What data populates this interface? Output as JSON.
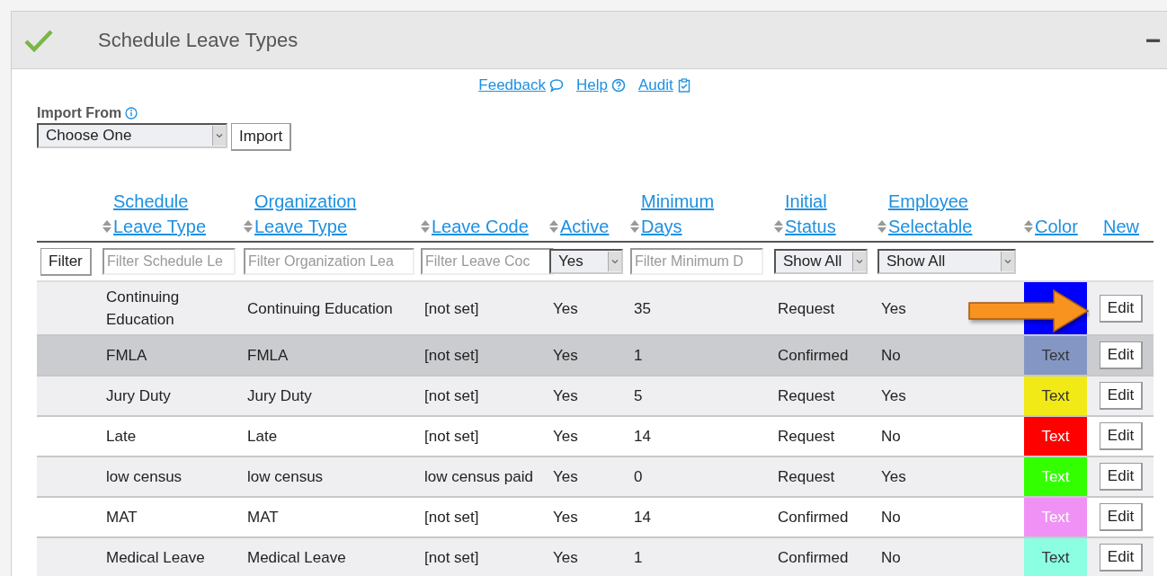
{
  "panel": {
    "title": "Schedule Leave Types",
    "collapse": "−"
  },
  "links": [
    {
      "label": "Feedback",
      "kind": "speech"
    },
    {
      "label": "Help",
      "kind": "help"
    },
    {
      "label": "Audit",
      "kind": "clipboard"
    }
  ],
  "import": {
    "label": "Import From",
    "select": "Choose One",
    "button": "Import"
  },
  "table": {
    "filter_button": "Filter",
    "columns": [
      {
        "label": "Schedule\nLeave Type",
        "sortable": true,
        "filter": {
          "kind": "text",
          "placeholder": "Filter Schedule Le"
        }
      },
      {
        "label": "Organization\nLeave Type",
        "sortable": true,
        "filter": {
          "kind": "text",
          "placeholder": "Filter Organization Lea"
        }
      },
      {
        "label": "Leave Code",
        "sortable": true,
        "filter": {
          "kind": "text",
          "placeholder": "Filter Leave Coc"
        }
      },
      {
        "label": "Active",
        "sortable": true,
        "filter": {
          "kind": "select",
          "value": "Yes"
        }
      },
      {
        "label": "Minimum\nDays",
        "sortable": true,
        "filter": {
          "kind": "text",
          "placeholder": "Filter Minimum D"
        }
      },
      {
        "label": "Initial\nStatus",
        "sortable": true,
        "filter": {
          "kind": "select",
          "value": "Show All"
        }
      },
      {
        "label": "Employee\nSelectable",
        "sortable": true,
        "filter": {
          "kind": "select",
          "value": "Show All"
        }
      },
      {
        "label": "Color",
        "sortable": true
      },
      {
        "label": "New",
        "sortable": false
      }
    ],
    "rows": [
      {
        "cells": [
          "Continuing Education",
          "Continuing Education",
          "[not set]",
          "Yes",
          "35",
          "Request",
          "Yes"
        ],
        "color": "#0000ff",
        "selected": false,
        "arrow": true,
        "edit": "Edit"
      },
      {
        "cells": [
          "FMLA",
          "FMLA",
          "[not set]",
          "Yes",
          "1",
          "Confirmed",
          "No"
        ],
        "color": "#8497c4",
        "color_label": "Text",
        "label_light": false,
        "selected": true,
        "arrow": false,
        "edit": "Edit"
      },
      {
        "cells": [
          "Jury Duty",
          "Jury Duty",
          "[not set]",
          "Yes",
          "5",
          "Request",
          "Yes"
        ],
        "color": "#f2ea17",
        "color_label": "Text",
        "label_light": false,
        "selected": false,
        "arrow": false,
        "edit": "Edit"
      },
      {
        "cells": [
          "Late",
          "Late",
          "[not set]",
          "Yes",
          "14",
          "Request",
          "No"
        ],
        "color": "#ff0000",
        "color_label": "Text",
        "label_light": true,
        "selected": false,
        "arrow": false,
        "edit": "Edit"
      },
      {
        "cells": [
          "low census",
          "low census",
          "low census paid",
          "Yes",
          "0",
          "Request",
          "Yes"
        ],
        "color": "#33ff00",
        "color_label": "Text",
        "label_light": true,
        "selected": false,
        "arrow": false,
        "edit": "Edit"
      },
      {
        "cells": [
          "MAT",
          "MAT",
          "[not set]",
          "Yes",
          "14",
          "Confirmed",
          "No"
        ],
        "color": "#f092f5",
        "color_label": "Text",
        "label_light": true,
        "selected": false,
        "arrow": false,
        "edit": "Edit"
      },
      {
        "cells": [
          "Medical Leave",
          "Medical Leave",
          "[not set]",
          "Yes",
          "1",
          "Confirmed",
          "No"
        ],
        "color": "#8cffe3",
        "color_label": "Text",
        "label_light": false,
        "selected": false,
        "arrow": false,
        "edit": "Edit"
      }
    ]
  }
}
